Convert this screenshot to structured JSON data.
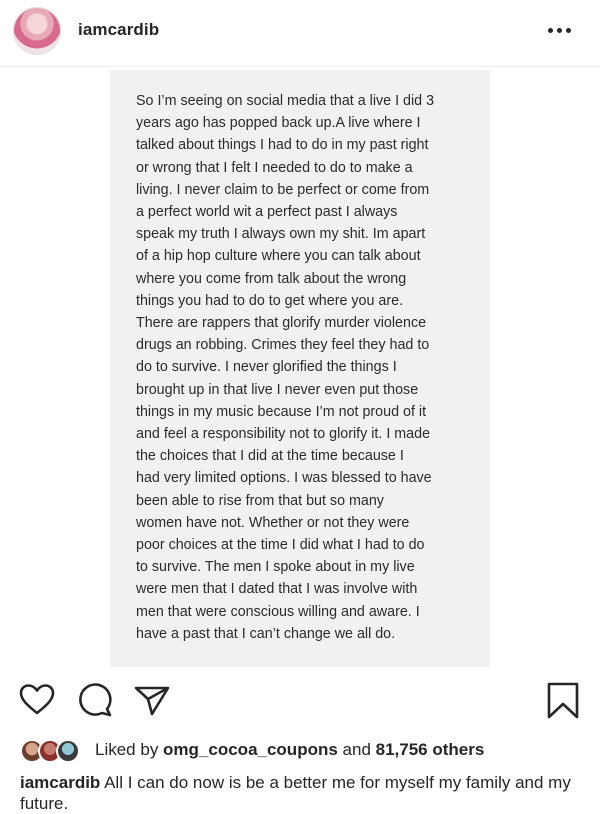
{
  "post": {
    "username": "iamcardib",
    "note_text": "So I’m seeing on social media that a live I did 3\nyears ago has popped back up.A live where I\ntalked about things I had to do in my past right\nor wrong that I felt I needed to do to make a\nliving. I never claim to be perfect or come from\na perfect world wit a perfect past I always\nspeak my truth I always own my shit. Im apart\nof a hip hop culture where you can talk about\nwhere you come from talk about the wrong\nthings you had to do to get where you are.\nThere are rappers that glorify murder violence\ndrugs an robbing. Crimes they feel they had to\ndo to survive. I never glorified the things I\nbrought up in that live I never even put those\nthings in my music because I’m not proud of it\nand feel a responsibility not to glorify it. I made\nthe choices that I did at the time because I\nhad very limited options. I was blessed to have\nbeen able to rise from that but so many\nwomen have not. Whether or not they were\npoor choices at the time I did what I had to do\nto survive. The men I spoke about in my live\nwere men that I dated that I was involve with\nmen that were conscious willing and aware. I\nhave a past that I can’t change we all do."
  },
  "likes": {
    "prefix": "Liked by ",
    "user": "omg_cocoa_coupons",
    "middle": " and ",
    "count": "81,756 others"
  },
  "caption": {
    "username": "iamcardib",
    "text": " All I can do now is be a better me for myself my family and my future."
  },
  "icons": [
    "more-options-icon",
    "heart-icon",
    "comment-icon",
    "share-icon",
    "bookmark-icon"
  ],
  "colors": {
    "text": "#262626",
    "note_bg": "#f2f1f0",
    "divider": "#efefef"
  }
}
